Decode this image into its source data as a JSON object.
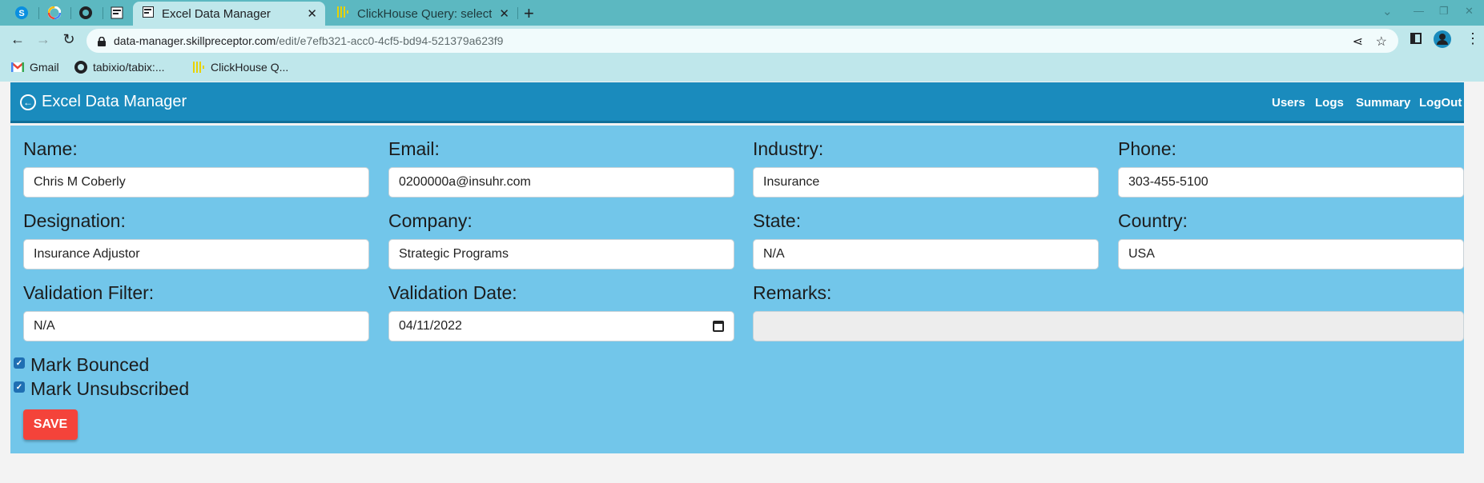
{
  "browser": {
    "tabs": [
      {
        "title": "Excel Data Manager",
        "active": true
      },
      {
        "title": "ClickHouse Query: select",
        "active": false
      }
    ],
    "url_host": "data-manager.skillpreceptor.com",
    "url_path": "/edit/e7efb321-acc0-4cf5-bd94-521379a623f9",
    "bookmarks": [
      {
        "label": "Gmail",
        "icon": "gmail-icon"
      },
      {
        "label": "tabixio/tabix:...",
        "icon": "github-icon"
      },
      {
        "label": "ClickHouse Q...",
        "icon": "clickhouse-icon"
      }
    ]
  },
  "app": {
    "title": "Excel Data Manager",
    "nav": {
      "users": "Users",
      "logs": "Logs",
      "summary": "Summary",
      "logout": "LogOut"
    }
  },
  "form": {
    "name": {
      "label": "Name:",
      "value": "Chris M Coberly"
    },
    "email": {
      "label": "Email:",
      "value": "0200000a@insuhr.com"
    },
    "industry": {
      "label": "Industry:",
      "value": "Insurance"
    },
    "phone": {
      "label": "Phone:",
      "value": "303-455-5100"
    },
    "designation": {
      "label": "Designation:",
      "value": "Insurance Adjustor"
    },
    "company": {
      "label": "Company:",
      "value": "Strategic Programs"
    },
    "state": {
      "label": "State:",
      "value": "N/A"
    },
    "country": {
      "label": "Country:",
      "value": "USA"
    },
    "validation_filter": {
      "label": "Validation Filter:",
      "value": "N/A"
    },
    "validation_date": {
      "label": "Validation Date:",
      "value": "04/11/2022"
    },
    "remarks": {
      "label": "Remarks:",
      "value": ""
    },
    "mark_bounced": {
      "label": "Mark Bounced",
      "checked": true
    },
    "mark_unsubscribed": {
      "label": "Mark Unsubscribed",
      "checked": true
    },
    "save_label": "SAVE"
  },
  "colors": {
    "header": "#1a8bbd",
    "panel": "#72c6ea",
    "save": "#f4433a",
    "tabstrip": "#5cb8c1"
  }
}
